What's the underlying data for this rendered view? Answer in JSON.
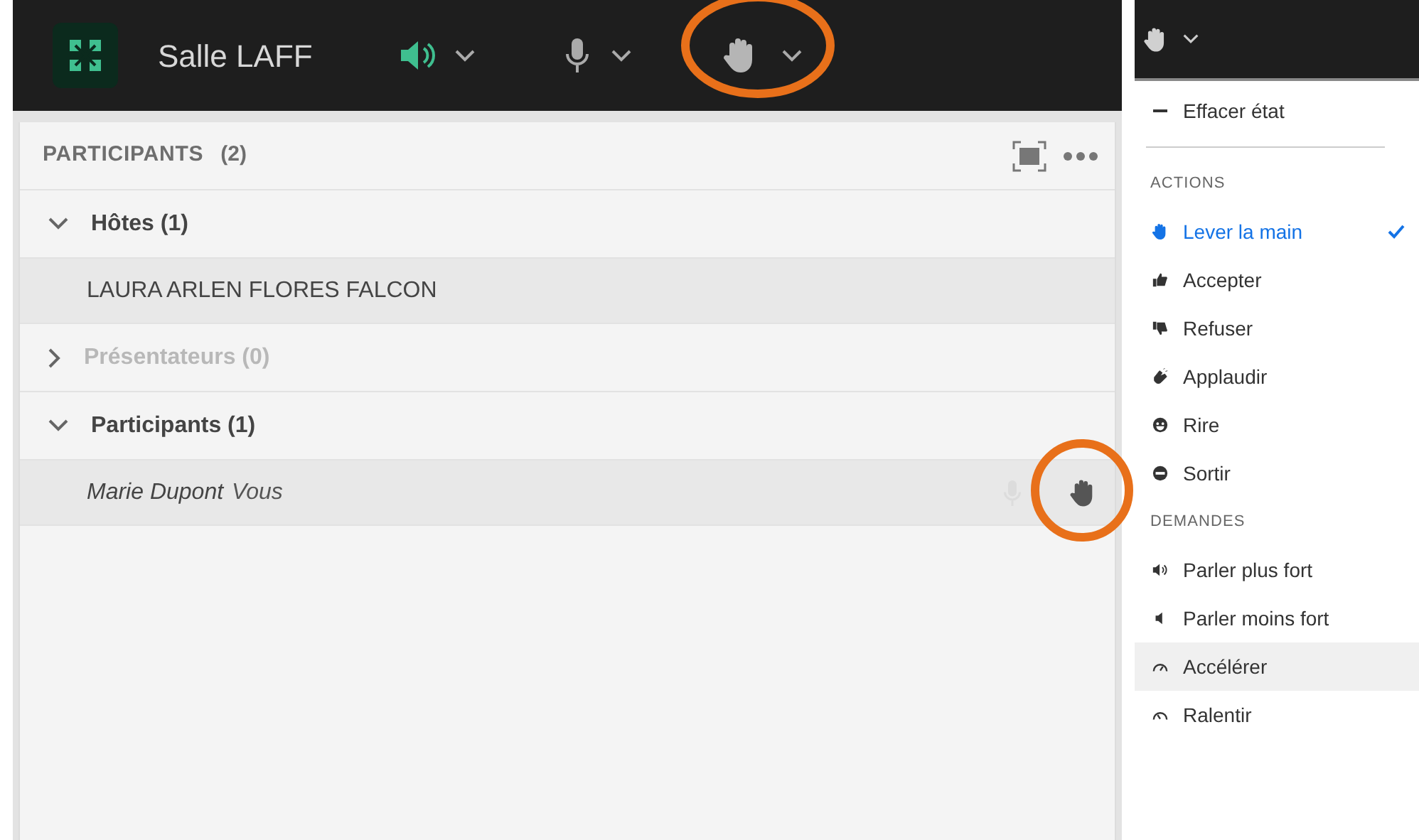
{
  "room": {
    "title": "Salle LAFF"
  },
  "participants_panel": {
    "title": "PARTICIPANTS",
    "count": "(2)",
    "groups": [
      {
        "label": "Hôtes (1)",
        "expanded": true,
        "disabled": false,
        "children": [
          {
            "name": "LAURA ARLEN FLORES FALCON",
            "italic": false
          }
        ]
      },
      {
        "label": "Présentateurs (0)",
        "expanded": false,
        "disabled": true
      },
      {
        "label": "Participants (1)",
        "expanded": true,
        "disabled": false,
        "children": [
          {
            "name": "Marie Dupont",
            "tag": "Vous",
            "italic": true,
            "hand_raised": true
          }
        ]
      }
    ]
  },
  "status_menu": {
    "items": [
      {
        "kind": "item",
        "label": "Effacer état",
        "selected": false,
        "hovered": false
      },
      {
        "kind": "divider"
      },
      {
        "kind": "heading",
        "label": "ACTIONS"
      },
      {
        "kind": "item",
        "label": "Lever la main",
        "selected": true,
        "hovered": false
      },
      {
        "kind": "item",
        "label": "Accepter",
        "selected": false,
        "hovered": false
      },
      {
        "kind": "item",
        "label": "Refuser",
        "selected": false,
        "hovered": false
      },
      {
        "kind": "item",
        "label": "Applaudir",
        "selected": false,
        "hovered": false
      },
      {
        "kind": "item",
        "label": "Rire",
        "selected": false,
        "hovered": false
      },
      {
        "kind": "item",
        "label": "Sortir",
        "selected": false,
        "hovered": false
      },
      {
        "kind": "heading",
        "label": "DEMANDES"
      },
      {
        "kind": "item",
        "label": "Parler plus fort",
        "selected": false,
        "hovered": false
      },
      {
        "kind": "item",
        "label": "Parler moins fort",
        "selected": false,
        "hovered": false
      },
      {
        "kind": "item",
        "label": "Accélérer",
        "selected": false,
        "hovered": true
      },
      {
        "kind": "item",
        "label": "Ralentir",
        "selected": false,
        "hovered": false
      }
    ]
  }
}
